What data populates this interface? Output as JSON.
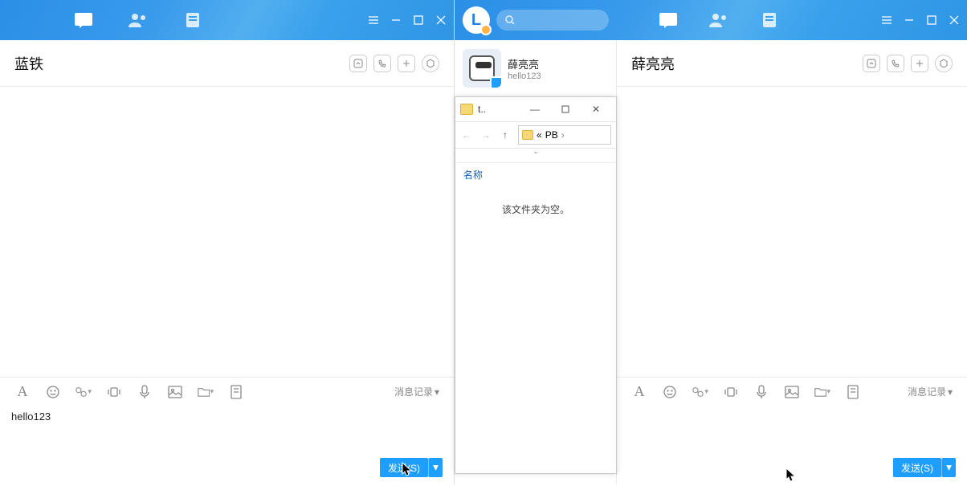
{
  "left": {
    "chat_title": "蓝铁",
    "input_text": "hello123",
    "history_label": "消息记录",
    "send_label": "发送(S)"
  },
  "right": {
    "chat_title": "薛亮亮",
    "history_label": "消息记录",
    "send_label": "发送(S)",
    "friend": {
      "name": "薛亮亮",
      "uid": "hello123"
    }
  },
  "explorer": {
    "title": "t..",
    "breadcrumb_prefix": "«",
    "breadcrumb_folder": "PB",
    "column_name": "名称",
    "empty_text": "该文件夹为空。"
  },
  "send_dropdown_glyph": "▾",
  "history_dropdown_glyph": "▾",
  "crumb_sep_glyph": "›"
}
